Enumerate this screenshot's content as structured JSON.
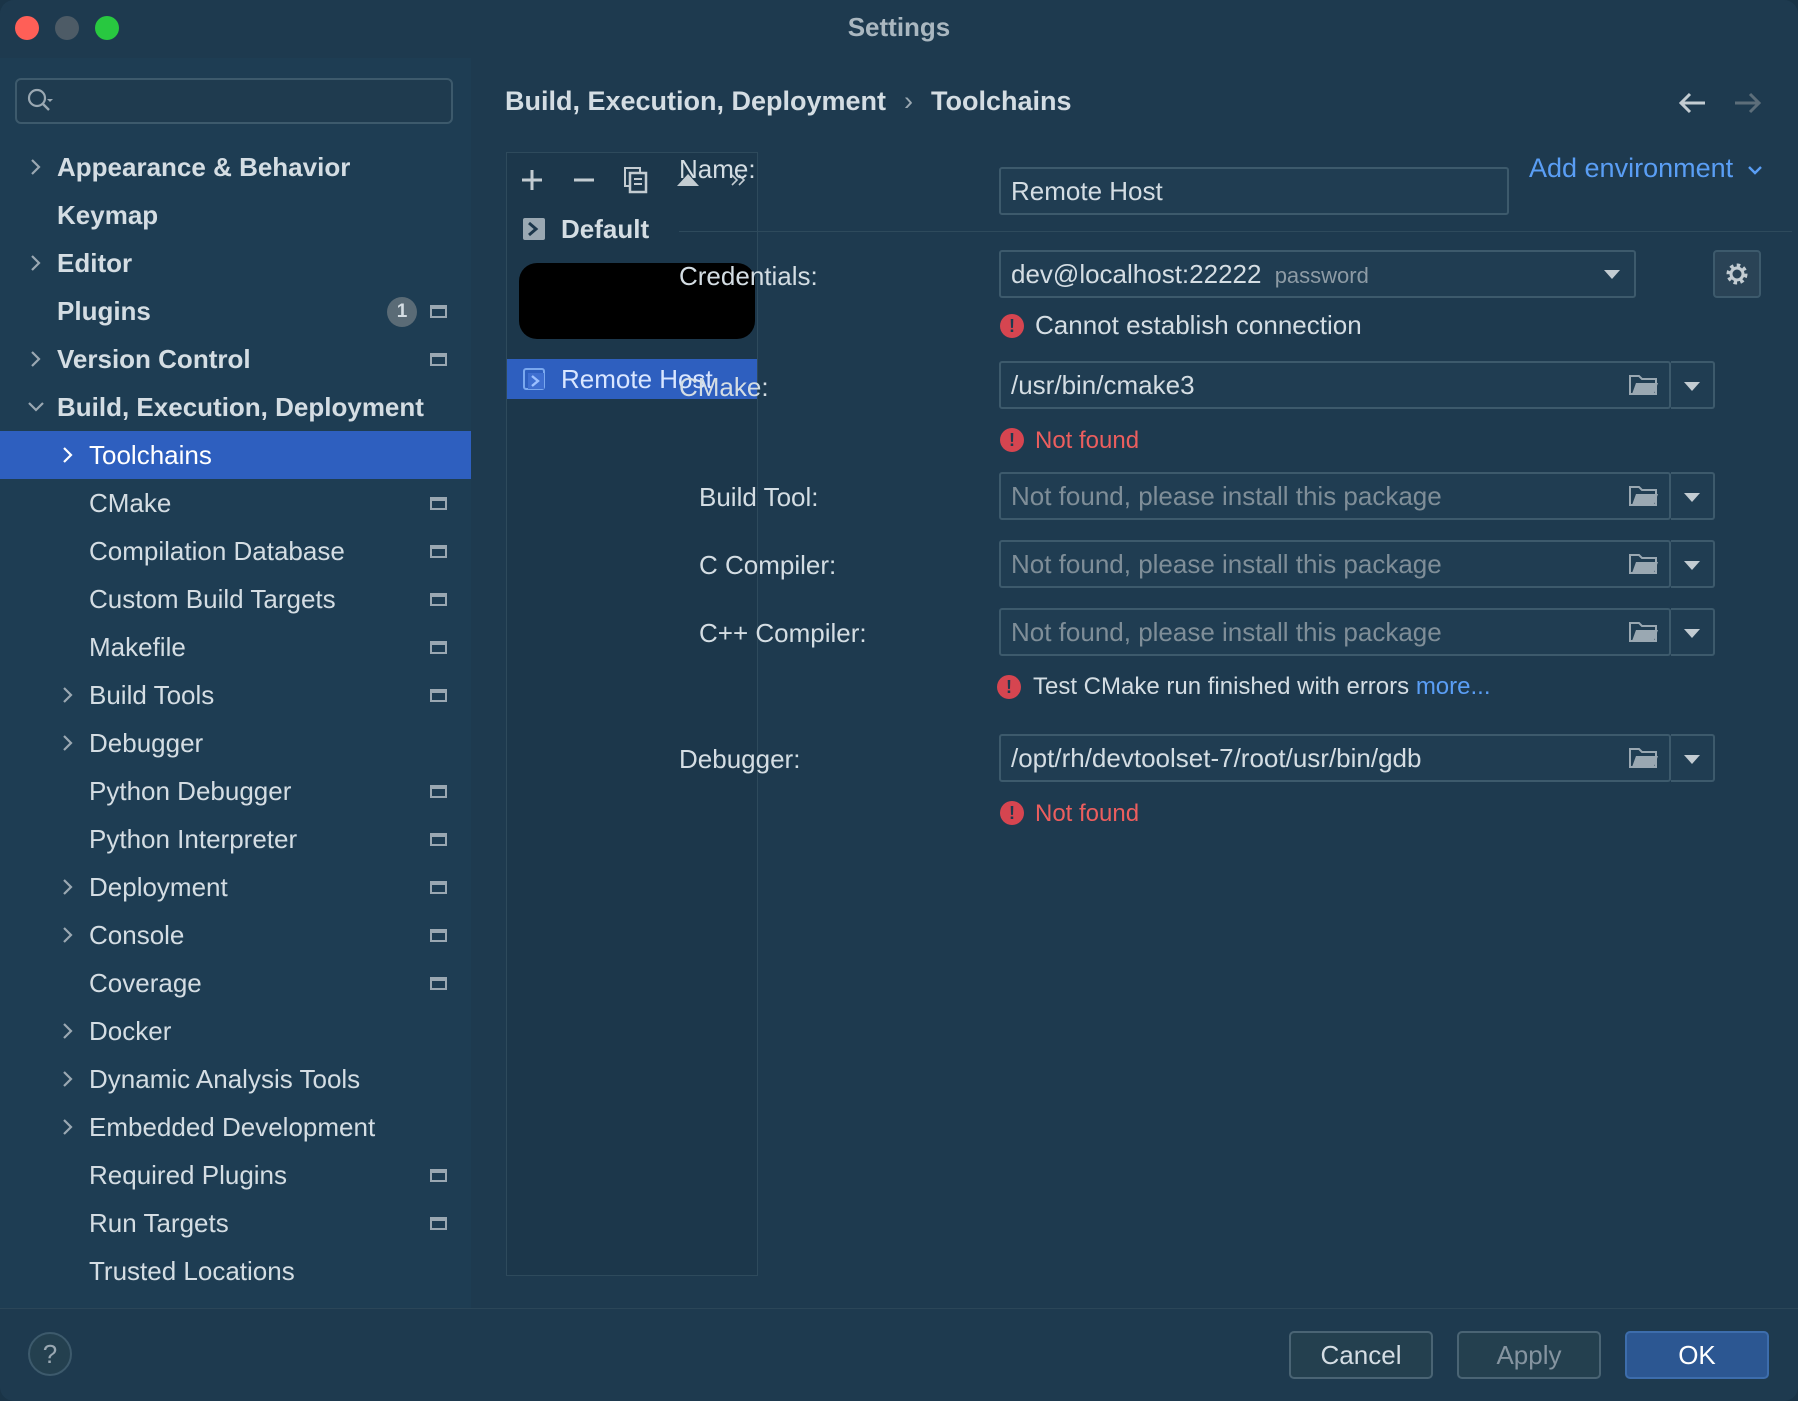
{
  "window": {
    "title": "Settings"
  },
  "search": {
    "placeholder": ""
  },
  "sidebar": {
    "items": [
      {
        "label": "Appearance & Behavior",
        "level": 0,
        "expandable": true,
        "expanded": false,
        "bold": true,
        "page_icon": false
      },
      {
        "label": "Keymap",
        "level": 0,
        "expandable": false,
        "bold": true,
        "page_icon": false
      },
      {
        "label": "Editor",
        "level": 0,
        "expandable": true,
        "expanded": false,
        "bold": true,
        "page_icon": false
      },
      {
        "label": "Plugins",
        "level": 0,
        "expandable": false,
        "bold": true,
        "page_icon": true,
        "badge": "1"
      },
      {
        "label": "Version Control",
        "level": 0,
        "expandable": true,
        "expanded": false,
        "bold": true,
        "page_icon": true
      },
      {
        "label": "Build, Execution, Deployment",
        "level": 0,
        "expandable": true,
        "expanded": true,
        "bold": true,
        "page_icon": false
      },
      {
        "label": "Toolchains",
        "level": 1,
        "expandable": true,
        "expanded": false,
        "selected": true,
        "page_icon": false
      },
      {
        "label": "CMake",
        "level": 1,
        "expandable": false,
        "page_icon": true
      },
      {
        "label": "Compilation Database",
        "level": 1,
        "expandable": false,
        "page_icon": true
      },
      {
        "label": "Custom Build Targets",
        "level": 1,
        "expandable": false,
        "page_icon": true
      },
      {
        "label": "Makefile",
        "level": 1,
        "expandable": false,
        "page_icon": true
      },
      {
        "label": "Build Tools",
        "level": 1,
        "expandable": true,
        "expanded": false,
        "page_icon": true
      },
      {
        "label": "Debugger",
        "level": 1,
        "expandable": true,
        "expanded": false,
        "page_icon": false
      },
      {
        "label": "Python Debugger",
        "level": 1,
        "expandable": false,
        "page_icon": true
      },
      {
        "label": "Python Interpreter",
        "level": 1,
        "expandable": false,
        "page_icon": true
      },
      {
        "label": "Deployment",
        "level": 1,
        "expandable": true,
        "expanded": false,
        "page_icon": true
      },
      {
        "label": "Console",
        "level": 1,
        "expandable": true,
        "expanded": false,
        "page_icon": true
      },
      {
        "label": "Coverage",
        "level": 1,
        "expandable": false,
        "page_icon": true
      },
      {
        "label": "Docker",
        "level": 1,
        "expandable": true,
        "expanded": false,
        "page_icon": false
      },
      {
        "label": "Dynamic Analysis Tools",
        "level": 1,
        "expandable": true,
        "expanded": false,
        "page_icon": false
      },
      {
        "label": "Embedded Development",
        "level": 1,
        "expandable": true,
        "expanded": false,
        "page_icon": false
      },
      {
        "label": "Required Plugins",
        "level": 1,
        "expandable": false,
        "page_icon": true
      },
      {
        "label": "Run Targets",
        "level": 1,
        "expandable": false,
        "page_icon": true
      },
      {
        "label": "Trusted Locations",
        "level": 1,
        "expandable": false,
        "page_icon": false
      }
    ]
  },
  "breadcrumb": {
    "parent": "Build, Execution, Deployment",
    "separator": "›",
    "current": "Toolchains"
  },
  "toolchains": {
    "items": [
      {
        "label": "Default",
        "bold": true,
        "selected": false
      },
      {
        "label": "",
        "redacted": true
      },
      {
        "label": "Remote Host",
        "bold": false,
        "selected": true
      }
    ]
  },
  "form": {
    "name": {
      "label": "Name:",
      "value": "Remote Host"
    },
    "add_environment": "Add environment",
    "credentials": {
      "label": "Credentials:",
      "value": "dev@localhost:22222",
      "suffix": "password",
      "error": "Cannot establish connection"
    },
    "cmake": {
      "label": "CMake:",
      "value": "/usr/bin/cmake3",
      "error": "Not found"
    },
    "build_tool": {
      "label": "Build Tool:",
      "placeholder": "Not found, please install this package"
    },
    "c_compiler": {
      "label": "C Compiler:",
      "placeholder": "Not found, please install this package"
    },
    "cpp_compiler": {
      "label": "C++ Compiler:",
      "placeholder": "Not found, please install this package"
    },
    "test_cmake": {
      "message": "Test CMake run finished with errors",
      "link": "more..."
    },
    "debugger": {
      "label": "Debugger:",
      "value": "/opt/rh/devtoolset-7/root/usr/bin/gdb",
      "error": "Not found"
    }
  },
  "footer": {
    "help": "?",
    "cancel": "Cancel",
    "apply": "Apply",
    "ok": "OK"
  },
  "colors": {
    "accent": "#2e5fbf",
    "error": "#ec5e5e",
    "link": "#5a9ef5",
    "background": "#1e3a4f"
  }
}
